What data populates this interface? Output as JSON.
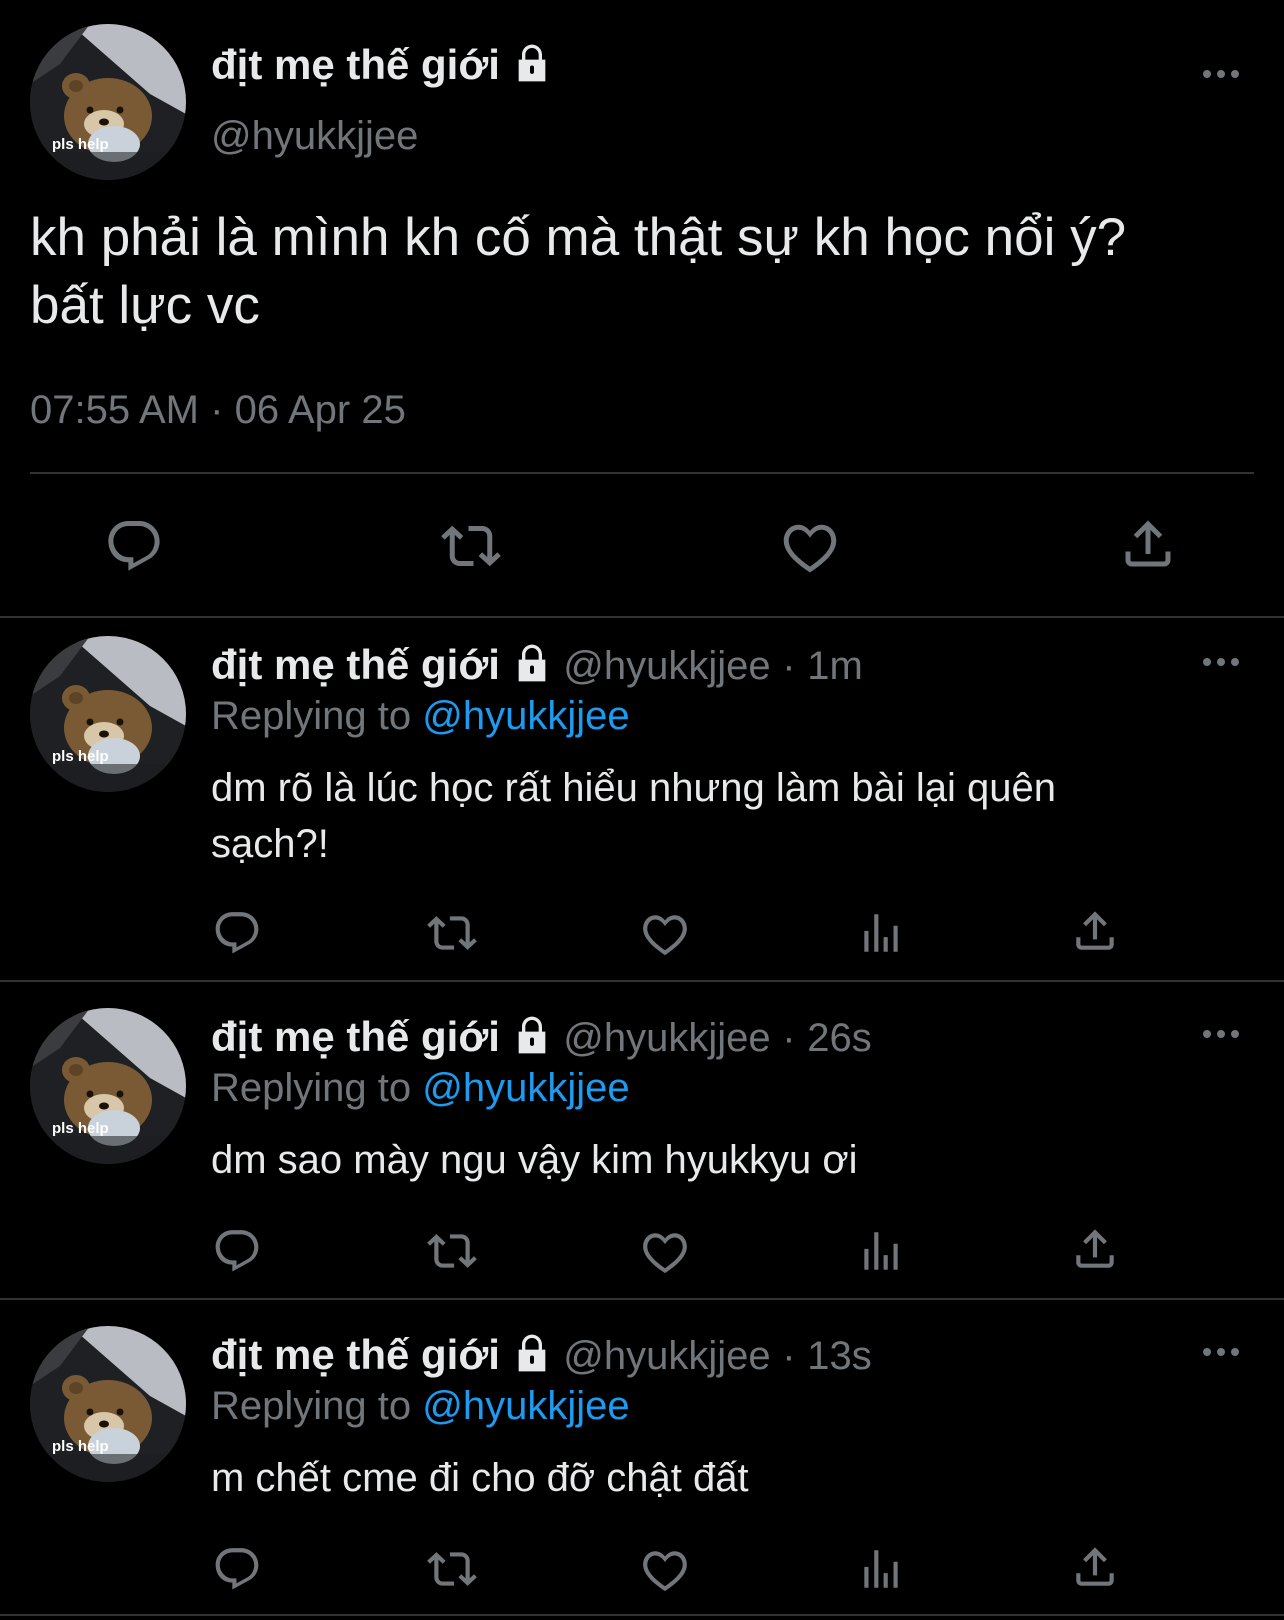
{
  "main_tweet": {
    "display_name": "địt mẹ thế giới",
    "handle": "@hyukkjjee",
    "avatar_caption": "pls help",
    "text_line1": "kh phải là mình kh cố mà thật sự kh học nổi ý?",
    "text_line2": "bất lực vc",
    "time": "07:55 AM",
    "separator": "·",
    "date": "06 Apr 25"
  },
  "replies": [
    {
      "display_name": "địt mẹ thế giới",
      "handle": "@hyukkjjee",
      "age": "1m",
      "replying_prefix": "Replying to",
      "replying_handle": "@hyukkjjee",
      "text_line1": "dm rõ là lúc học rất hiểu nhưng làm bài lại quên",
      "text_line2": "sạch?!",
      "avatar_caption": "pls help"
    },
    {
      "display_name": "địt mẹ thế giới",
      "handle": "@hyukkjjee",
      "age": "26s",
      "replying_prefix": "Replying to",
      "replying_handle": "@hyukkjjee",
      "text_line1": "dm sao mày ngu vậy kim hyukkyu ơi",
      "avatar_caption": "pls help"
    },
    {
      "display_name": "địt mẹ thế giới",
      "handle": "@hyukkjjee",
      "age": "13s",
      "replying_prefix": "Replying to",
      "replying_handle": "@hyukkjjee",
      "text_line1": "m chết cme đi cho đỡ chật đất",
      "avatar_caption": "pls help"
    }
  ],
  "icons": {
    "reply": "reply-icon",
    "retweet": "retweet-icon",
    "like": "heart-icon",
    "views": "views-icon",
    "share": "share-icon",
    "more": "more-icon",
    "lock": "lock-icon"
  },
  "colors": {
    "background": "#000000",
    "text": "#e7e9ea",
    "muted": "#71767b",
    "link": "#1d9bf0",
    "divider": "#2f3336"
  }
}
